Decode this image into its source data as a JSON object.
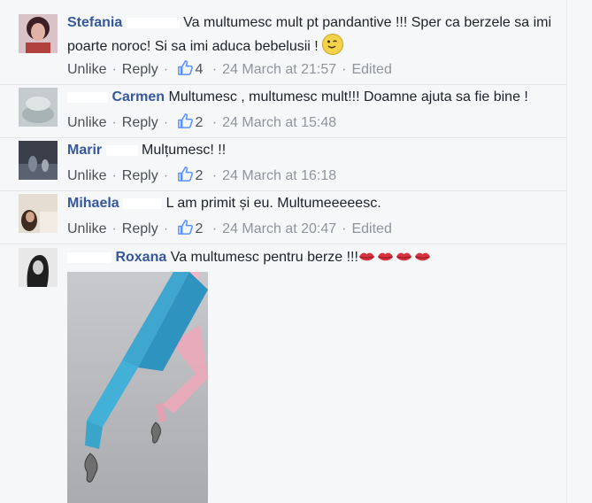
{
  "comments": [
    {
      "name": "Stefania",
      "text": "Va multumesc mult pt pandantive !!! Sper ca berzele sa imi poarte noroc! Si sa imi aduca bebelusii !",
      "actions": {
        "unlike": "Unlike",
        "reply": "Reply"
      },
      "likes": "4",
      "time": "24 March at 21:57",
      "edited": "Edited"
    },
    {
      "name": "Carmen",
      "text": "Multumesc , multumesc mult!!! Doamne ajuta sa fie bine !",
      "actions": {
        "unlike": "Unlike",
        "reply": "Reply"
      },
      "likes": "2",
      "time": "24 March at 15:48"
    },
    {
      "name": "Marir",
      "text": "Mulțumesc! !!",
      "actions": {
        "unlike": "Unlike",
        "reply": "Reply"
      },
      "likes": "2",
      "time": "24 March at 16:18"
    },
    {
      "name": "Mihaela",
      "text": "L am primit și eu. Multumeeeeesc.",
      "actions": {
        "unlike": "Unlike",
        "reply": "Reply"
      },
      "likes": "2",
      "time": "24 March at 20:47",
      "edited": "Edited"
    },
    {
      "name": "Roxana",
      "text": "Va multumesc pentru berze !!!"
    }
  ],
  "icons": {
    "like": "thumbs-up-icon",
    "wink": "winking-face-emoji",
    "kiss": "kiss-lips-emoji"
  },
  "colors": {
    "name": "#365899",
    "meta": "#90949c",
    "action": "#4b4f56",
    "like_blue": "#5890ff"
  }
}
